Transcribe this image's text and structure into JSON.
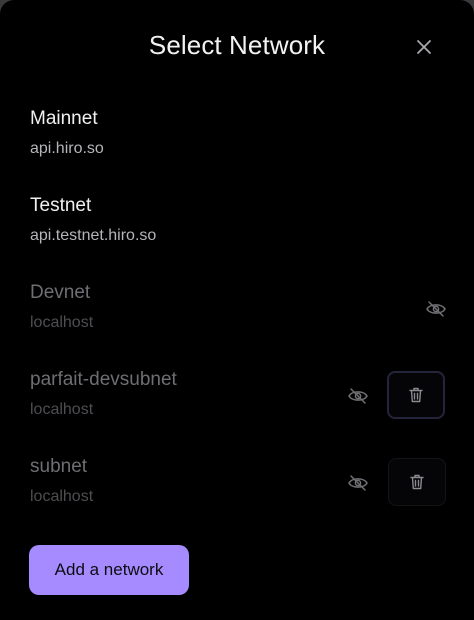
{
  "modal": {
    "title": "Select Network",
    "close_icon": "close-icon"
  },
  "networks": [
    {
      "name": "Mainnet",
      "url": "api.hiro.so",
      "hidden": false,
      "removable": false
    },
    {
      "name": "Testnet",
      "url": "api.testnet.hiro.so",
      "hidden": false,
      "removable": false
    },
    {
      "name": "Devnet",
      "url": "localhost",
      "hidden": true,
      "removable": false
    },
    {
      "name": "parfait-devsubnet",
      "url": "localhost",
      "hidden": true,
      "removable": true
    },
    {
      "name": "subnet",
      "url": "localhost",
      "hidden": true,
      "removable": true
    }
  ],
  "icons": {
    "hide": "eye-slash-icon",
    "delete": "trash-icon"
  },
  "actions": {
    "add_label": "Add a network"
  },
  "colors": {
    "background": "#000000",
    "accent": "#a58bff",
    "text_primary": "#f0f0f0",
    "text_muted": "#6e6e73"
  }
}
